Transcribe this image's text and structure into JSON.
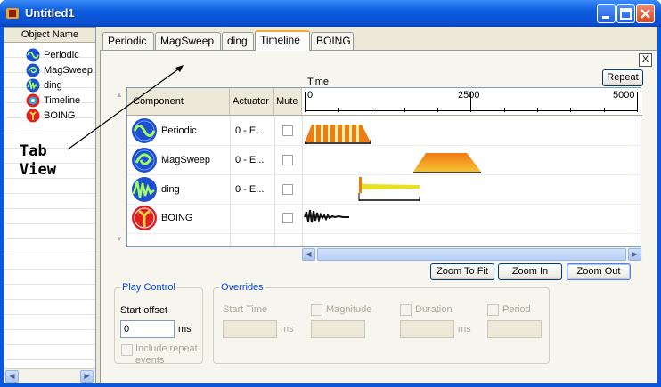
{
  "window": {
    "title": "Untitled1"
  },
  "object_list": {
    "header": "Object Name",
    "items": [
      {
        "label": "Periodic",
        "icon": "periodic-wave-icon"
      },
      {
        "label": "MagSweep",
        "icon": "magsweep-icon"
      },
      {
        "label": "ding",
        "icon": "ding-icon"
      },
      {
        "label": "Timeline",
        "icon": "timeline-icon"
      },
      {
        "label": "BOING",
        "icon": "boing-icon"
      }
    ]
  },
  "tabs": [
    "Periodic",
    "MagSweep",
    "ding",
    "Timeline",
    "BOING"
  ],
  "active_tab": "Timeline",
  "annotation": {
    "line1": "Tab",
    "line2": "View"
  },
  "timeline": {
    "repeat_button": "Repeat",
    "close_label": "X",
    "time_label": "Time",
    "columns": {
      "component": "Component",
      "actuator": "Actuator",
      "mute": "Mute"
    },
    "ruler_labels": [
      "0",
      "2500",
      "5000"
    ],
    "rows": [
      {
        "name": "Periodic",
        "actuator": "0 - E...",
        "muted": false
      },
      {
        "name": "MagSweep",
        "actuator": "0 - E...",
        "muted": false
      },
      {
        "name": "ding",
        "actuator": "0 - E...",
        "muted": false
      },
      {
        "name": "BOING",
        "actuator": "",
        "muted": false
      }
    ],
    "zoom_buttons": {
      "fit": "Zoom To Fit",
      "in": "Zoom In",
      "out": "Zoom Out"
    }
  },
  "play_control": {
    "legend": "Play Control",
    "start_offset_label": "Start offset",
    "start_offset_value": "0",
    "unit": "ms",
    "include_repeat_label": "Include repeat",
    "include_repeat_label2": "events"
  },
  "overrides": {
    "legend": "Overrides",
    "start_time_label": "Start Time",
    "start_time_unit": "ms",
    "magnitude_label": "Magnitude",
    "duration_label": "Duration",
    "duration_unit": "ms",
    "period_label": "Period"
  },
  "colors": {
    "accent_tab": "#f5a935",
    "periodic": "#f07a14",
    "ding": "#e8e020",
    "boing": "#111111"
  }
}
